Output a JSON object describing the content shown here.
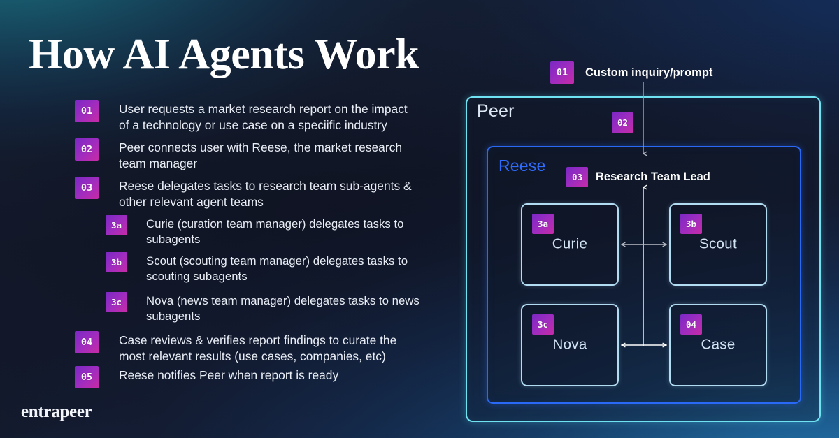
{
  "page": {
    "title": "How AI Agents Work",
    "logo": "entrapeer"
  },
  "colors": {
    "badge_gradient_start": "#7b28c4",
    "badge_gradient_end": "#c72ba6",
    "peer_border": "#6fe3f2",
    "reese_border": "#2a69f5",
    "agent_border": "#b2dcf2",
    "reese_label": "#2f6bff",
    "peer_label": "#dce8f3",
    "connector": "#ffffff",
    "body_text": "#e9edf5"
  },
  "steps": [
    {
      "num": "01",
      "text": "User requests a market research report on the impact of a technology or use case on a speciific industry",
      "level": "main"
    },
    {
      "num": "02",
      "text": "Peer connects user with Reese, the market research team manager",
      "level": "main"
    },
    {
      "num": "03",
      "text": "Reese delegates tasks to research team sub-agents & other relevant agent teams",
      "level": "main"
    },
    {
      "num": "3a",
      "text": "Curie (curation team manager) delegates tasks to subagents",
      "level": "sub"
    },
    {
      "num": "3b",
      "text": "Scout (scouting team manager) delegates tasks to scouting subagents",
      "level": "sub"
    },
    {
      "num": "3c",
      "text": "Nova (news team manager) delegates tasks to news subagents",
      "level": "sub"
    },
    {
      "num": "04",
      "text": "Case reviews & verifies report findings to curate the most relevant results (use cases, companies, etc)",
      "level": "main"
    },
    {
      "num": "05",
      "text": "Reese notifies Peer when report is ready",
      "level": "main"
    }
  ],
  "diagram": {
    "top_label": {
      "num": "01",
      "text": "Custom inquiry/prompt"
    },
    "peer": {
      "label": "Peer",
      "badge": "02"
    },
    "reese": {
      "label": "Reese",
      "lead_badge": "03",
      "lead_label": "Research Team Lead"
    },
    "agents": [
      {
        "badge": "3a",
        "name": "Curie"
      },
      {
        "badge": "3b",
        "name": "Scout"
      },
      {
        "badge": "3c",
        "name": "Nova"
      },
      {
        "badge": "04",
        "name": "Case"
      }
    ]
  }
}
